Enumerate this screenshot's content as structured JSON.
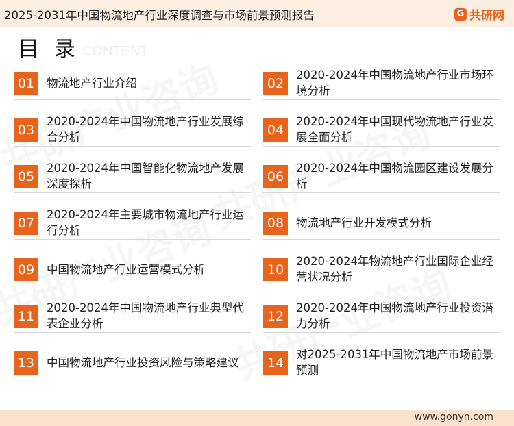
{
  "header": {
    "title": "2025-2031年中国物流地产行业深度调查与市场前景预测报告",
    "logo_text": "共研网"
  },
  "toc": {
    "heading": "目 录",
    "heading_en": "CONTENT",
    "items": [
      {
        "num": "01",
        "label": "物流地产行业介绍"
      },
      {
        "num": "02",
        "label": "2020-2024年中国物流地产行业市场环境分析"
      },
      {
        "num": "03",
        "label": "2020-2024年中国物流地产行业发展综合分析"
      },
      {
        "num": "04",
        "label": "2020-2024年中国现代物流地产行业发展全面分析"
      },
      {
        "num": "05",
        "label": "2020-2024年中国智能化物流地产发展深度探析"
      },
      {
        "num": "06",
        "label": "2020-2024年中国物流园区建设发展分析"
      },
      {
        "num": "07",
        "label": "2020-2024年主要城市物流地产行业运行分析"
      },
      {
        "num": "08",
        "label": "物流地产行业开发模式分析"
      },
      {
        "num": "09",
        "label": "中国物流地产行业运营模式分析"
      },
      {
        "num": "10",
        "label": "2020-2024年物流地产行业国际企业经营状况分析"
      },
      {
        "num": "11",
        "label": "2020-2024年中国物流地产行业典型代表企业分析"
      },
      {
        "num": "12",
        "label": "2020-2024年中国物流地产行业投资潜力分析"
      },
      {
        "num": "13",
        "label": "中国物流地产行业投资风险与策略建议"
      },
      {
        "num": "14",
        "label": "对2025-2031年中国物流地产市场前景预测"
      }
    ]
  },
  "footer": {
    "website": "www.gonyn.com"
  },
  "colors": {
    "accent": "#e8641c",
    "topbar": "#fdeee2",
    "footer": "#fbe3d0"
  }
}
